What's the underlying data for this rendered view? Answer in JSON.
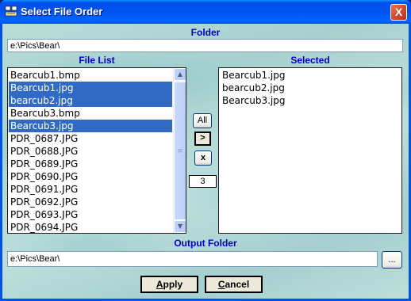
{
  "window": {
    "title": "Select File Order",
    "close_glyph": "X",
    "icon": "folder-list-icon"
  },
  "folder": {
    "label": "Folder",
    "value": "e:\\Pics\\Bear\\"
  },
  "file_list": {
    "label": "File List",
    "items": [
      {
        "name": "Bearcub1.bmp",
        "selected": false
      },
      {
        "name": "Bearcub1.jpg",
        "selected": true
      },
      {
        "name": "bearcub2.jpg",
        "selected": true
      },
      {
        "name": "Bearcub3.bmp",
        "selected": false
      },
      {
        "name": "Bearcub3.jpg",
        "selected": true
      },
      {
        "name": "PDR_0687.JPG",
        "selected": false
      },
      {
        "name": "PDR_0688.JPG",
        "selected": false
      },
      {
        "name": "PDR_0689.JPG",
        "selected": false
      },
      {
        "name": "PDR_0690.JPG",
        "selected": false
      },
      {
        "name": "PDR_0691.JPG",
        "selected": false
      },
      {
        "name": "PDR_0692.JPG",
        "selected": false
      },
      {
        "name": "PDR_0693.JPG",
        "selected": false
      },
      {
        "name": "PDR_0694.JPG",
        "selected": false
      }
    ],
    "selection_color": "#316ac5"
  },
  "selected_list": {
    "label": "Selected",
    "items": [
      "Bearcub1.jpg",
      "bearcub2.jpg",
      "Bearcub3.jpg"
    ]
  },
  "transfer": {
    "all_label": "All",
    "add_label": ">",
    "remove_label": "x",
    "count": "3"
  },
  "output_folder": {
    "label": "Output Folder",
    "value": "e:\\Pics\\Bear\\",
    "browse_label": "..."
  },
  "buttons": {
    "apply_first": "A",
    "apply_rest": "pply",
    "cancel_first": "C",
    "cancel_rest": "ancel"
  },
  "colors": {
    "label_blue": "#0000c8",
    "title_bar": "#0054e3",
    "close_red": "#d1472a"
  }
}
